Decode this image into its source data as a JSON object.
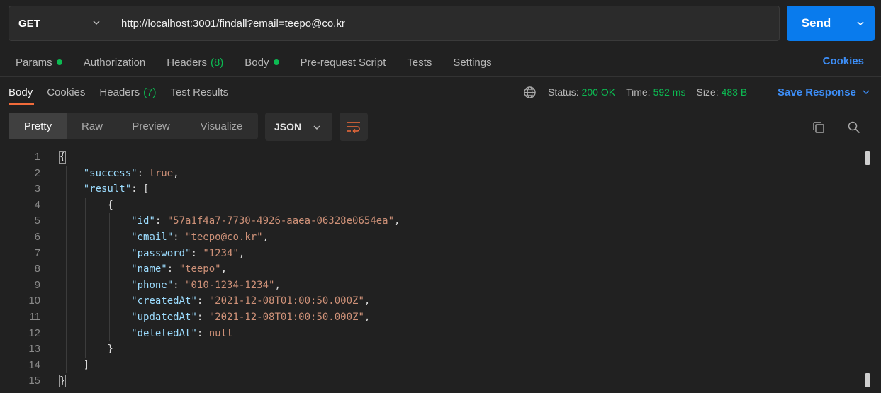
{
  "request": {
    "method": "GET",
    "url": "http://localhost:3001/findall?email=teepo@co.kr",
    "send_label": "Send"
  },
  "request_tabs": [
    {
      "label": "Params",
      "dot": true
    },
    {
      "label": "Authorization"
    },
    {
      "label": "Headers",
      "count": "(8)"
    },
    {
      "label": "Body",
      "dot": true
    },
    {
      "label": "Pre-request Script"
    },
    {
      "label": "Tests"
    },
    {
      "label": "Settings"
    }
  ],
  "cookies_label": "Cookies",
  "response_tabs": [
    {
      "label": "Body",
      "active": true
    },
    {
      "label": "Cookies"
    },
    {
      "label": "Headers",
      "count": "(7)"
    },
    {
      "label": "Test Results"
    }
  ],
  "status": {
    "status_label": "Status:",
    "status_value": "200 OK",
    "time_label": "Time:",
    "time_value": "592 ms",
    "size_label": "Size:",
    "size_value": "483 B"
  },
  "save_response_label": "Save Response",
  "view_modes": [
    "Pretty",
    "Raw",
    "Preview",
    "Visualize"
  ],
  "active_view": "Pretty",
  "format": "JSON",
  "icons": {
    "method_dropdown": "chevron-down-icon",
    "send_dropdown": "chevron-down-icon",
    "network": "globe-icon",
    "wrap": "wrap-lines-icon",
    "copy": "copy-icon",
    "search": "search-icon"
  },
  "colors": {
    "accent_blue": "#097bed",
    "link_blue": "#3d8ef7",
    "success_green": "#0cbb52",
    "active_tab_underline": "#f26b3a",
    "json_key": "#9cdcfe",
    "json_value": "#ce9178"
  },
  "code_lines": [
    {
      "n": "1",
      "tokens": [
        [
          "p",
          "{"
        ]
      ]
    },
    {
      "n": "2",
      "tokens": [
        [
          "p",
          "    "
        ],
        [
          "k",
          "\"success\""
        ],
        [
          "p",
          ": "
        ],
        [
          "b",
          "true"
        ],
        [
          "p",
          ","
        ]
      ]
    },
    {
      "n": "3",
      "tokens": [
        [
          "p",
          "    "
        ],
        [
          "k",
          "\"result\""
        ],
        [
          "p",
          ": ["
        ]
      ]
    },
    {
      "n": "4",
      "tokens": [
        [
          "p",
          "        {"
        ]
      ]
    },
    {
      "n": "5",
      "tokens": [
        [
          "p",
          "            "
        ],
        [
          "k",
          "\"id\""
        ],
        [
          "p",
          ": "
        ],
        [
          "s",
          "\"57a1f4a7-7730-4926-aaea-06328e0654ea\""
        ],
        [
          "p",
          ","
        ]
      ]
    },
    {
      "n": "6",
      "tokens": [
        [
          "p",
          "            "
        ],
        [
          "k",
          "\"email\""
        ],
        [
          "p",
          ": "
        ],
        [
          "s",
          "\"teepo@co.kr\""
        ],
        [
          "p",
          ","
        ]
      ]
    },
    {
      "n": "7",
      "tokens": [
        [
          "p",
          "            "
        ],
        [
          "k",
          "\"password\""
        ],
        [
          "p",
          ": "
        ],
        [
          "s",
          "\"1234\""
        ],
        [
          "p",
          ","
        ]
      ]
    },
    {
      "n": "8",
      "tokens": [
        [
          "p",
          "            "
        ],
        [
          "k",
          "\"name\""
        ],
        [
          "p",
          ": "
        ],
        [
          "s",
          "\"teepo\""
        ],
        [
          "p",
          ","
        ]
      ]
    },
    {
      "n": "9",
      "tokens": [
        [
          "p",
          "            "
        ],
        [
          "k",
          "\"phone\""
        ],
        [
          "p",
          ": "
        ],
        [
          "s",
          "\"010-1234-1234\""
        ],
        [
          "p",
          ","
        ]
      ]
    },
    {
      "n": "10",
      "tokens": [
        [
          "p",
          "            "
        ],
        [
          "k",
          "\"createdAt\""
        ],
        [
          "p",
          ": "
        ],
        [
          "s",
          "\"2021-12-08T01:00:50.000Z\""
        ],
        [
          "p",
          ","
        ]
      ]
    },
    {
      "n": "11",
      "tokens": [
        [
          "p",
          "            "
        ],
        [
          "k",
          "\"updatedAt\""
        ],
        [
          "p",
          ": "
        ],
        [
          "s",
          "\"2021-12-08T01:00:50.000Z\""
        ],
        [
          "p",
          ","
        ]
      ]
    },
    {
      "n": "12",
      "tokens": [
        [
          "p",
          "            "
        ],
        [
          "k",
          "\"deletedAt\""
        ],
        [
          "p",
          ": "
        ],
        [
          "n",
          "null"
        ]
      ]
    },
    {
      "n": "13",
      "tokens": [
        [
          "p",
          "        }"
        ]
      ]
    },
    {
      "n": "14",
      "tokens": [
        [
          "p",
          "    ]"
        ]
      ]
    },
    {
      "n": "15",
      "tokens": [
        [
          "p",
          "}"
        ]
      ]
    }
  ]
}
